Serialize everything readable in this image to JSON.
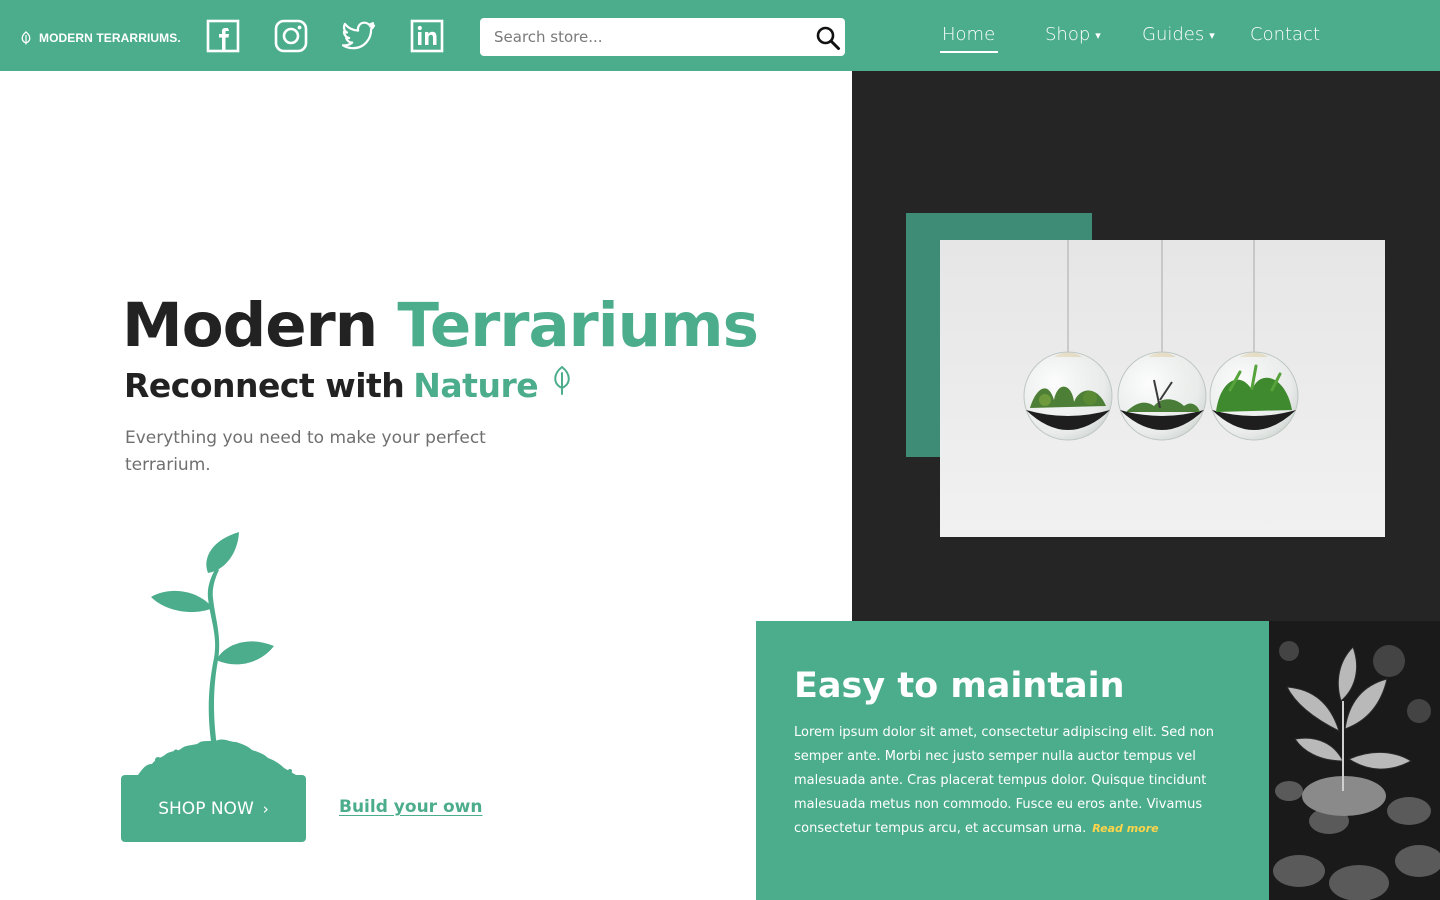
{
  "header": {
    "brand": "MODERN TERARRIUMS.",
    "social": [
      "facebook-icon",
      "instagram-icon",
      "twitter-icon",
      "linkedin-icon"
    ],
    "search_placeholder": "Search store...",
    "nav": {
      "home": "Home",
      "shop": "Shop",
      "guides": "Guides",
      "contact": "Contact",
      "caret": "▾",
      "active": "Home"
    }
  },
  "hero": {
    "title_main": "Modern",
    "title_accent": "Terrariums",
    "subtitle_main": "Reconnect with",
    "subtitle_accent": "Nature",
    "description": "Everything you need to make your perfect terrarium.",
    "shop_button": "SHOP NOW",
    "shop_button_chevron": "›",
    "build_link": "Build your own",
    "image": "three hanging glass-globe terrariums on light background"
  },
  "feature": {
    "title": "Easy to maintain",
    "text": "Lorem ipsum dolor sit amet, consectetur adipiscing elit. Sed non semper ante. Morbi nec justo semper nulla auctor tempus vel malesuada ante. Cras placerat tempus dolor. Quisque tincidunt malesuada metus non commodo. Fusce eu eros ante. Vivamus consectetur tempus arcu, et accumsan urna.",
    "read_more": "Read more",
    "image": "black and white close-up of nerve plant among pebbles"
  },
  "colors": {
    "brand_green": "#4CAD8D",
    "dark_green": "#3E8C76",
    "dark_panel": "#252525",
    "read_more_yellow": "#FFD54A",
    "heading": "#222222"
  }
}
